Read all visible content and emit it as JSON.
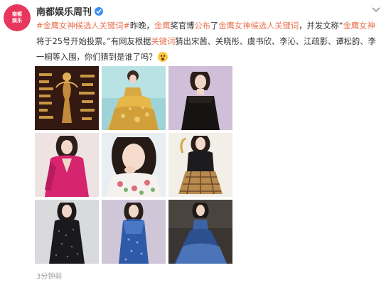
{
  "account": {
    "avatar_text_line1": "南都",
    "avatar_text_line2": "娱乐",
    "name": "南都娱乐周刊",
    "verified": true
  },
  "post": {
    "segments": [
      {
        "text": "#金鹰女神候选人关键词#",
        "style": "tag"
      },
      {
        "text": "昨晚，",
        "style": "plain"
      },
      {
        "text": "金鹰",
        "style": "hl"
      },
      {
        "text": "奖官博",
        "style": "plain"
      },
      {
        "text": "公布",
        "style": "hl"
      },
      {
        "text": "了",
        "style": "plain"
      },
      {
        "text": "金鹰女神候选人关键词",
        "style": "hl"
      },
      {
        "text": "，并发文称“",
        "style": "plain"
      },
      {
        "text": "金鹰女神",
        "style": "hl"
      },
      {
        "text": "将于25号开始投票。”有网友根据",
        "style": "plain"
      },
      {
        "text": "关键词",
        "style": "hl"
      },
      {
        "text": "猜出宋茜、关晓彤、虞书欣、李沁、江疏影、谭松韵、李一桐等入围，你们猜到是谁了吗？",
        "style": "plain"
      }
    ],
    "emoji": "wow-emoji"
  },
  "photos": [
    {
      "name": "photo-1",
      "theme": "dark-keywords"
    },
    {
      "name": "photo-2",
      "theme": "gold-gown"
    },
    {
      "name": "photo-3",
      "theme": "black-dress-lilac"
    },
    {
      "name": "photo-4",
      "theme": "pink-blazer"
    },
    {
      "name": "photo-5",
      "theme": "floral-portrait"
    },
    {
      "name": "photo-6",
      "theme": "plaid-skirt"
    },
    {
      "name": "photo-7",
      "theme": "dark-sparkle-dress"
    },
    {
      "name": "photo-8",
      "theme": "blue-sequin-dress"
    },
    {
      "name": "photo-9",
      "theme": "blue-ball-gown"
    }
  ],
  "timestamp": "3分钟前",
  "colors": {
    "link": "#eb7350",
    "avatar": "#e8365c",
    "verified": "#3d8ef7"
  }
}
